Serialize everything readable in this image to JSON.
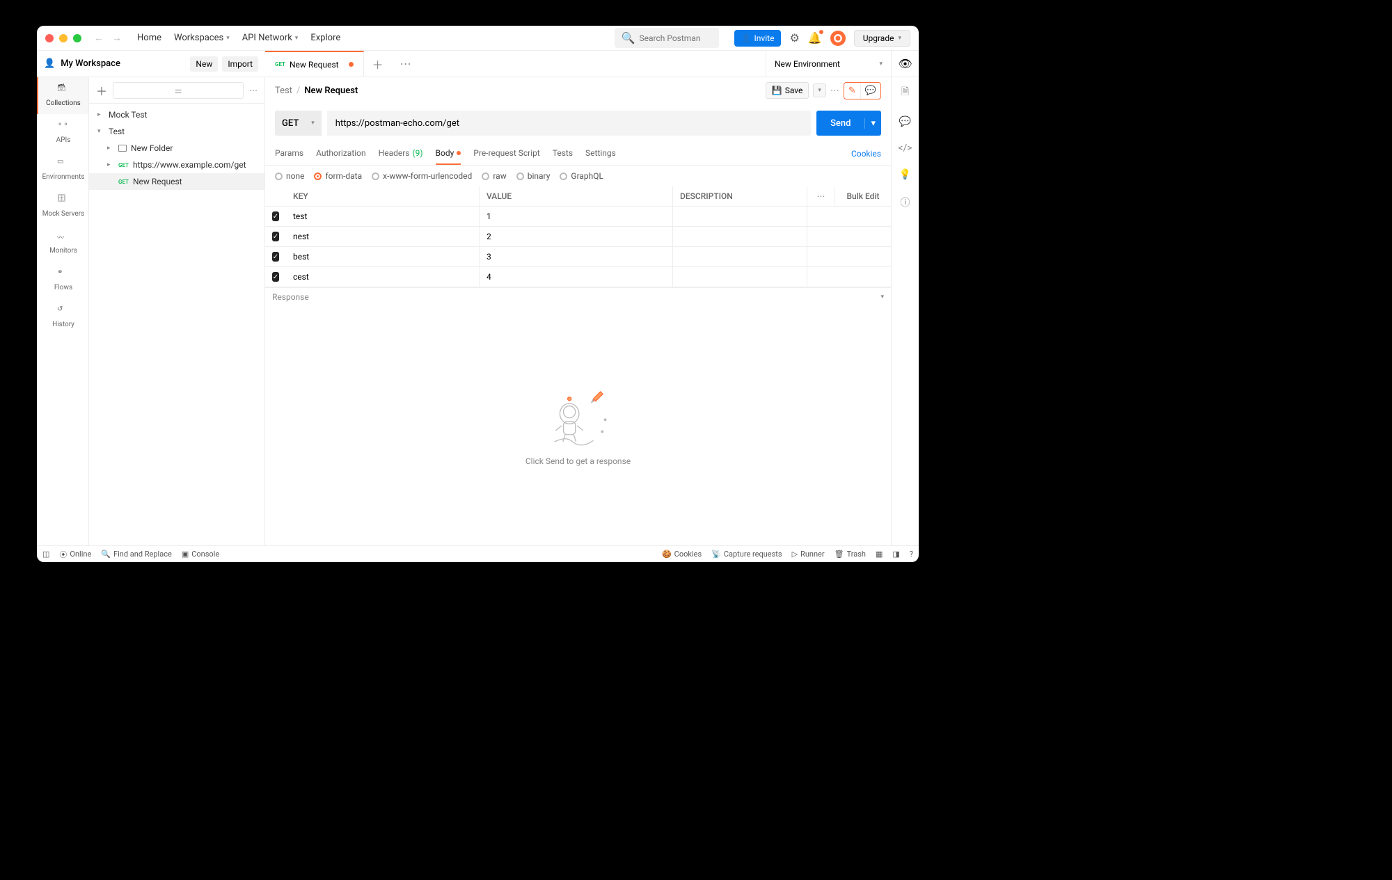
{
  "topmenu": {
    "home": "Home",
    "workspaces": "Workspaces",
    "apinetwork": "API Network",
    "explore": "Explore"
  },
  "search": {
    "placeholder": "Search Postman"
  },
  "buttons": {
    "invite": "Invite",
    "upgrade": "Upgrade",
    "new": "New",
    "import": "Import",
    "save": "Save",
    "send": "Send",
    "bulkedit": "Bulk Edit"
  },
  "workspace": {
    "name": "My Workspace"
  },
  "rail": {
    "collections": "Collections",
    "apis": "APIs",
    "environments": "Environments",
    "mockservers": "Mock Servers",
    "monitors": "Monitors",
    "flows": "Flows",
    "history": "History"
  },
  "tree": {
    "mocktest": "Mock Test",
    "test": "Test",
    "newfolder": "New Folder",
    "req1": {
      "method": "GET",
      "name": "https://www.example.com/get"
    },
    "req2": {
      "method": "GET",
      "name": "New Request"
    }
  },
  "tab": {
    "method": "GET",
    "name": "New Request"
  },
  "env": {
    "selected": "New Environment"
  },
  "breadcrumb": {
    "parent": "Test",
    "current": "New Request"
  },
  "request": {
    "method": "GET",
    "url": "https://postman-echo.com/get"
  },
  "reqtabs": {
    "params": "Params",
    "auth": "Authorization",
    "headers": "Headers",
    "headers_count": "(9)",
    "body": "Body",
    "prereq": "Pre-request Script",
    "tests": "Tests",
    "settings": "Settings",
    "cookies": "Cookies"
  },
  "bodytypes": {
    "none": "none",
    "formdata": "form-data",
    "urlenc": "x-www-form-urlencoded",
    "raw": "raw",
    "binary": "binary",
    "graphql": "GraphQL"
  },
  "grid": {
    "headers": {
      "key": "KEY",
      "value": "VALUE",
      "desc": "DESCRIPTION"
    },
    "rows": [
      {
        "key": "test",
        "value": "1",
        "desc": ""
      },
      {
        "key": "nest",
        "value": "2",
        "desc": ""
      },
      {
        "key": "best",
        "value": "3",
        "desc": ""
      },
      {
        "key": "cest",
        "value": "4",
        "desc": ""
      }
    ]
  },
  "response": {
    "title": "Response",
    "empty": "Click Send to get a response"
  },
  "status": {
    "online": "Online",
    "find": "Find and Replace",
    "console": "Console",
    "cookies": "Cookies",
    "capture": "Capture requests",
    "runner": "Runner",
    "trash": "Trash"
  }
}
